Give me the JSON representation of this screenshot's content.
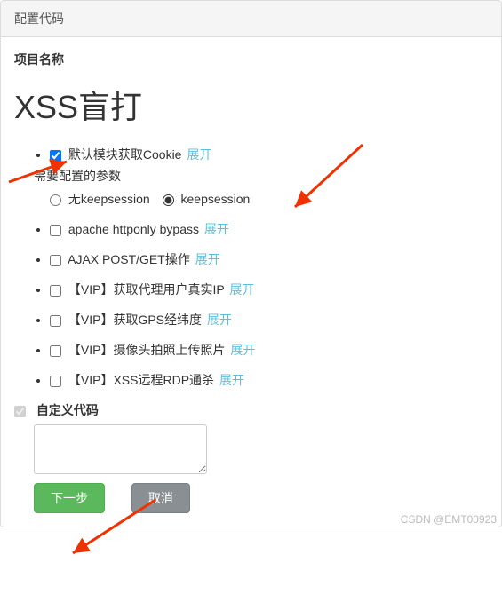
{
  "panel": {
    "title": "配置代码"
  },
  "section": {
    "project_label": "项目名称"
  },
  "project": {
    "title": "XSS盲打"
  },
  "modules": {
    "expand_label": "展开",
    "items": [
      {
        "label": "默认模块获取Cookie",
        "checked": true,
        "params_label": "需要配置的参数",
        "radios": {
          "opt1": "无keepsession",
          "opt2": "keepsession",
          "selected": "opt2"
        }
      },
      {
        "label": "apache httponly bypass",
        "checked": false
      },
      {
        "label": "AJAX POST/GET操作",
        "checked": false
      },
      {
        "label": "【VIP】获取代理用户真实IP",
        "checked": false
      },
      {
        "label": "【VIP】获取GPS经纬度",
        "checked": false
      },
      {
        "label": "【VIP】摄像头拍照上传照片",
        "checked": false
      },
      {
        "label": "【VIP】XSS远程RDP通杀",
        "checked": false
      }
    ]
  },
  "custom_code": {
    "label": "自定义代码",
    "value": ""
  },
  "buttons": {
    "next": "下一步",
    "cancel": "取消"
  },
  "watermark": "CSDN @EMT00923"
}
